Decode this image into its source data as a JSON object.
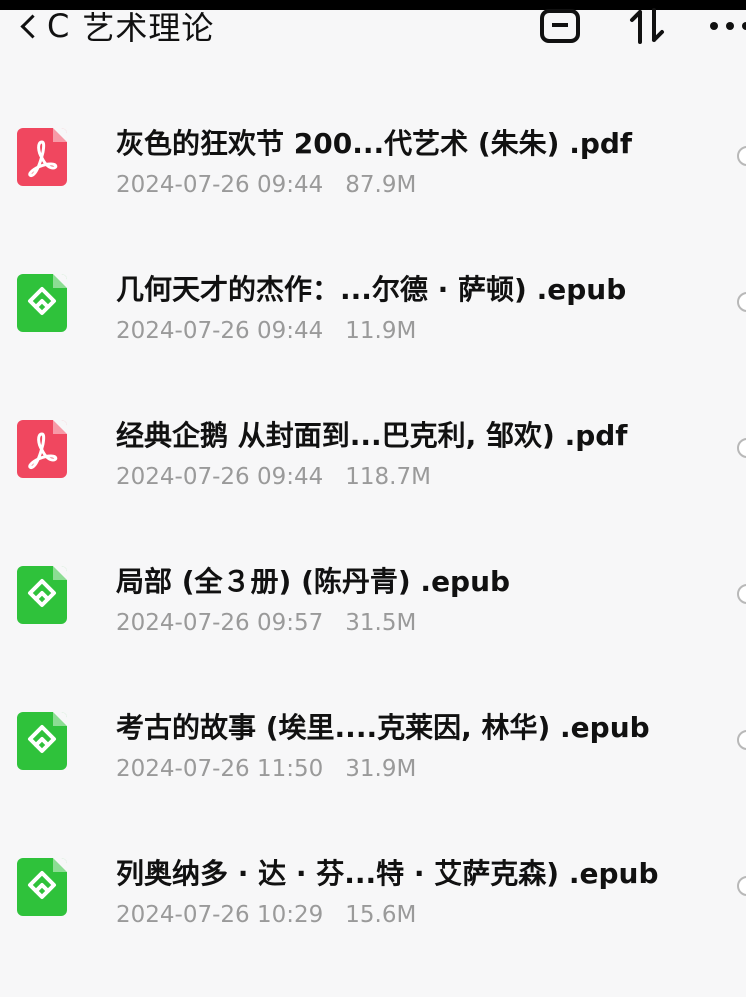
{
  "header": {
    "back_label": "C",
    "title": "艺术理论",
    "icons": [
      "back-chevron-icon",
      "select-square-icon",
      "sort-icon",
      "more-icon"
    ]
  },
  "files": [
    {
      "type": "pdf",
      "name": "灰色的狂欢节 200...代艺术 (朱朱) .pdf",
      "date": "2024-07-26 09:44",
      "size": "87.9M"
    },
    {
      "type": "epub",
      "name": "几何天才的杰作：...尔德 · 萨顿) .epub",
      "date": "2024-07-26 09:44",
      "size": "11.9M"
    },
    {
      "type": "pdf",
      "name": "经典企鹅 从封面到...巴克利, 邹欢) .pdf",
      "date": "2024-07-26 09:44",
      "size": "118.7M"
    },
    {
      "type": "epub",
      "name": "局部 (全３册) (陈丹青) .epub",
      "date": "2024-07-26 09:57",
      "size": "31.5M"
    },
    {
      "type": "epub",
      "name": "考古的故事 (埃里....克莱因, 林华) .epub",
      "date": "2024-07-26 11:50",
      "size": "31.9M"
    },
    {
      "type": "epub",
      "name": "列奥纳多 · 达 · 芬...特 · 艾萨克森) .epub",
      "date": "2024-07-26 10:29",
      "size": "15.6M"
    }
  ],
  "colors": {
    "pdf": "#f0475f",
    "epub": "#2fc23b",
    "meta_text": "#9a9a9a"
  }
}
